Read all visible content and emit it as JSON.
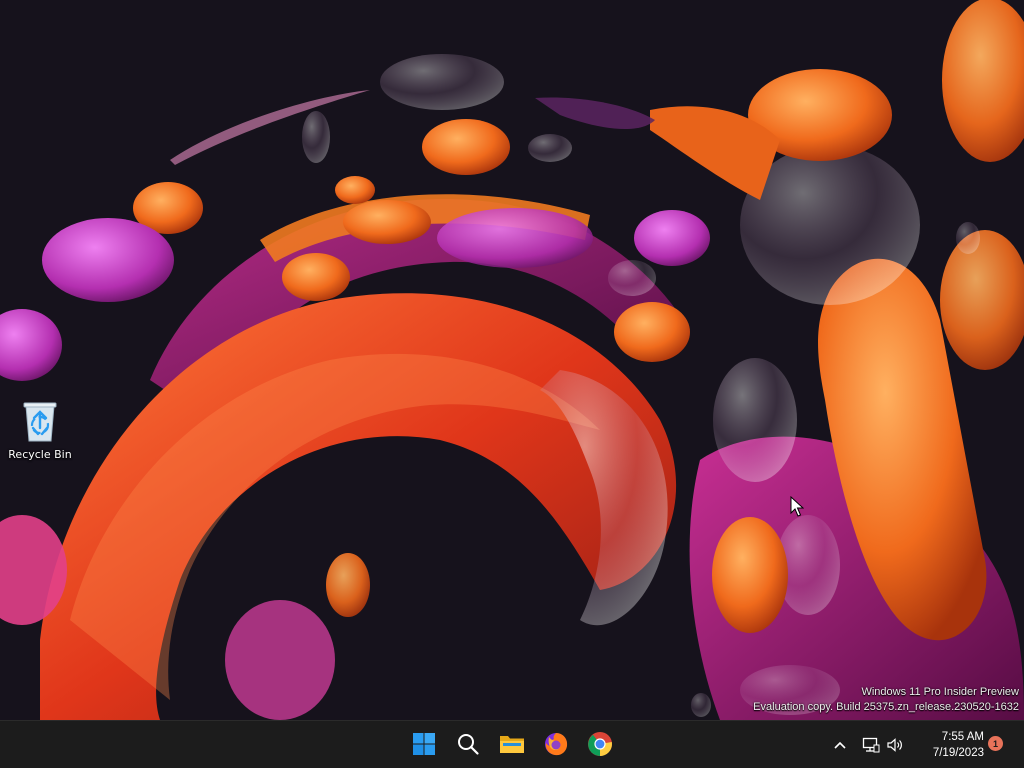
{
  "desktop": {
    "icons": [
      {
        "label": "Recycle Bin",
        "icon": "recycle-bin-icon"
      }
    ]
  },
  "watermark": {
    "line1": "Windows 11 Pro Insider Preview",
    "line2": "Evaluation copy. Build 25375.zn_release.230520-1632"
  },
  "taskbar": {
    "apps": [
      {
        "name": "Start",
        "icon": "windows-start-icon"
      },
      {
        "name": "Search",
        "icon": "search-icon"
      },
      {
        "name": "File Explorer",
        "icon": "folder-icon"
      },
      {
        "name": "Firefox",
        "icon": "firefox-icon"
      },
      {
        "name": "Chrome",
        "icon": "chrome-icon"
      }
    ],
    "tray": {
      "time": "7:55 AM",
      "date": "7/19/2023",
      "notification_count": "1"
    }
  },
  "colors": {
    "taskbar_bg": "#1c1c1c",
    "accent_blue": "#2a9cf0",
    "notification": "#e8735a"
  }
}
